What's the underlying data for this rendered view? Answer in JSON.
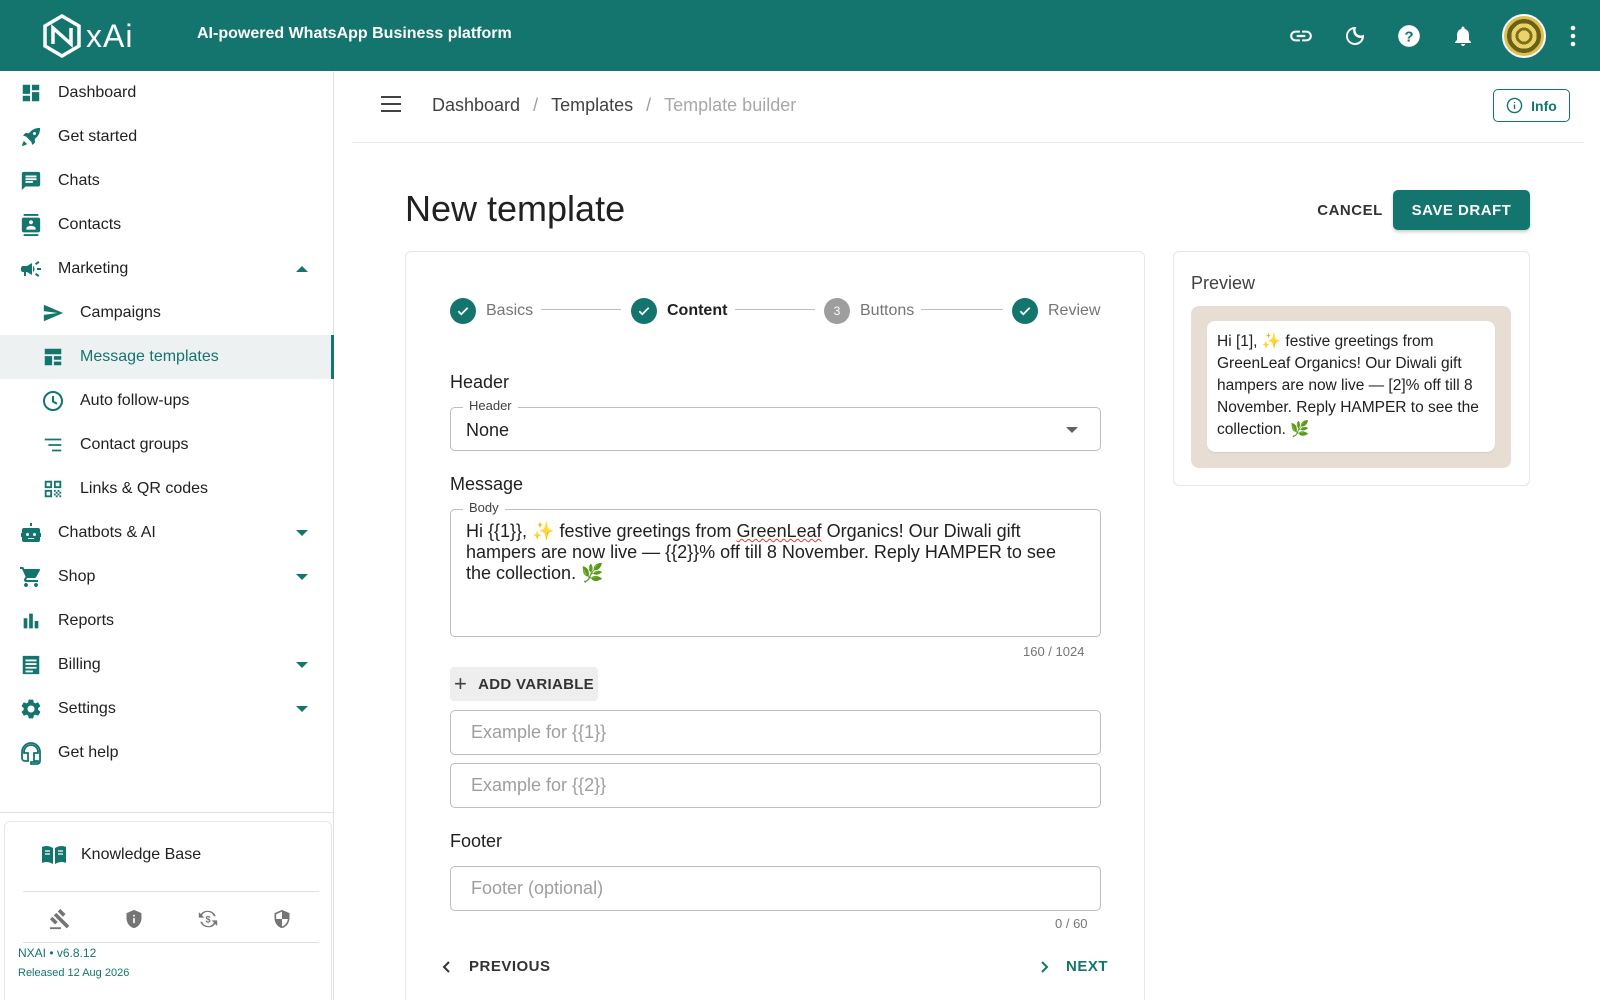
{
  "app": {
    "logo_text": "xAi",
    "logo_alt": "NXAI",
    "tagline": "AI-powered WhatsApp Business platform",
    "icons": [
      "link-icon",
      "moon-icon",
      "help-icon",
      "bell-icon",
      "avatar",
      "more-vert-icon"
    ]
  },
  "sidebar": {
    "items": [
      {
        "label": "Dashboard",
        "icon": "dashboard-icon"
      },
      {
        "label": "Get started",
        "icon": "rocket-icon"
      },
      {
        "label": "Chats",
        "icon": "chat-icon"
      },
      {
        "label": "Contacts",
        "icon": "contacts-icon"
      },
      {
        "label": "Marketing",
        "icon": "megaphone-icon",
        "expanded": true
      },
      {
        "label": "Campaigns",
        "icon": "send-icon"
      },
      {
        "label": "Message templates",
        "icon": "template-icon",
        "active": true
      },
      {
        "label": "Auto follow-ups",
        "icon": "clock-icon"
      },
      {
        "label": "Contact groups",
        "icon": "list-icon"
      },
      {
        "label": "Links & QR codes",
        "icon": "qr-code-icon"
      },
      {
        "label": "Chatbots & AI",
        "icon": "robot-icon"
      },
      {
        "label": "Shop",
        "icon": "cart-icon"
      },
      {
        "label": "Reports",
        "icon": "bar-chart-icon"
      },
      {
        "label": "Billing",
        "icon": "receipt-icon"
      },
      {
        "label": "Settings",
        "icon": "gear-icon"
      },
      {
        "label": "Get help",
        "icon": "support-icon"
      }
    ],
    "knowledge_base": "Knowledge Base",
    "tools": [
      "gavel-icon",
      "shield-info-icon",
      "currency-sync-icon",
      "shield-icon"
    ],
    "version": "NXAI • v6.8.12",
    "released": "Released 12 Aug 2026"
  },
  "breadcrumb": {
    "items": [
      "Dashboard",
      "Templates",
      "Template builder"
    ],
    "separator": "/",
    "info_label": "Info"
  },
  "page": {
    "title": "New template",
    "cancel_label": "CANCEL",
    "save_label": "SAVE DRAFT"
  },
  "stepper": {
    "steps": [
      {
        "label": "Basics",
        "state": "done"
      },
      {
        "label": "Content",
        "state": "active"
      },
      {
        "label": "Buttons",
        "state": "todo",
        "number": "3"
      },
      {
        "label": "Review",
        "state": "done"
      }
    ]
  },
  "form": {
    "header_section": "Header",
    "header_field_label": "Header",
    "header_value": "None",
    "message_section": "Message",
    "body_field_label": "Body",
    "body_part1": "Hi {{1}}, ✨ festive greetings from ",
    "body_misspelled": "GreenLeaf",
    "body_part2": " Organics! Our Diwali gift hampers are now live — {{2}}% off till 8 November. Reply HAMPER to see the collection. 🌿",
    "body_counter": "160 / 1024",
    "add_variable_label": "ADD VARIABLE",
    "example1_placeholder": "Example for {{1}}",
    "example2_placeholder": "Example for {{2}}",
    "footer_section": "Footer",
    "footer_placeholder": "Footer (optional)",
    "footer_counter": "0 / 60",
    "previous_label": "PREVIOUS",
    "next_label": "NEXT"
  },
  "preview": {
    "title": "Preview",
    "text": "Hi [1], ✨ festive greetings from GreenLeaf Organics! Our Diwali gift hampers are now live — [2]% off till 8 November. Reply HAMPER to see the collection. 🌿"
  },
  "colors": {
    "brand": "#13756d",
    "preview_bg": "#e7ddd3"
  }
}
